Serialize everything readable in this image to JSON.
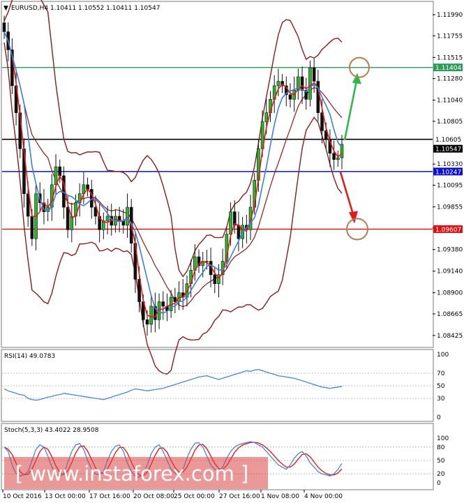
{
  "chart_data": {
    "type": "candlestick",
    "symbol_header": "EURUSD,H4  1.10411 1.10552 1.10411 1.10547",
    "symbol_marker": "▼",
    "price_axis": {
      "ylim": [
        1.083,
        1.1213
      ],
      "ticks": [
        "1.11990",
        "1.11755",
        "1.11515",
        "1.11280",
        "1.11040",
        "1.10805",
        "1.10330",
        "1.10095",
        "1.09855",
        "1.09620",
        "1.09380",
        "1.09140",
        "1.08900",
        "1.08665",
        "1.08425"
      ]
    },
    "levels": [
      {
        "name": "resistance",
        "value": 1.11404,
        "label": "1.11404",
        "color": "#2e9a5a"
      },
      {
        "name": "current",
        "value": 1.10605,
        "label": "1.10605",
        "color": "#000000"
      },
      {
        "name": "last",
        "value": 1.10547,
        "label": "1.10547",
        "color": "#000000"
      },
      {
        "name": "pivot",
        "value": 1.10247,
        "label": "1.10247",
        "color": "#1010cc"
      },
      {
        "name": "support",
        "value": 1.09607,
        "label": "1.09607",
        "color": "#dd1111"
      }
    ],
    "x_labels": [
      "10 Oct 2016",
      "13 Oct 00:00",
      "17 Oct 16:00",
      "20 Oct 08:00",
      "25 Oct 00:00",
      "27 Oct 16:00",
      "1 Nov 08:00",
      "4 Nov 00:00"
    ],
    "candles_close": [
      1.118,
      1.116,
      1.112,
      1.109,
      1.105,
      1.1,
      1.0975,
      1.095,
      1.1,
      1.099,
      1.098,
      1.0985,
      1.101,
      1.103,
      1.102,
      1.0985,
      1.096,
      1.0975,
      1.099,
      1.1,
      1.101,
      1.1005,
      1.0985,
      1.0975,
      1.096,
      1.097,
      1.0975,
      1.0965,
      1.0975,
      1.097,
      1.0965,
      1.0985,
      1.0945,
      1.0905,
      1.088,
      1.086,
      1.0855,
      1.0875,
      1.086,
      1.088,
      1.0875,
      1.087,
      1.0885,
      1.088,
      1.089,
      1.0885,
      1.09,
      1.0915,
      1.093,
      1.092,
      1.0925,
      1.0925,
      1.091,
      1.09,
      1.091,
      1.0925,
      1.0955,
      1.098,
      1.0965,
      1.095,
      1.0965,
      1.096,
      1.0985,
      1.1015,
      1.105,
      1.108,
      1.109,
      1.1105,
      1.112,
      1.1125,
      1.112,
      1.111,
      1.1105,
      1.1115,
      1.113,
      1.1115,
      1.1105,
      1.114,
      1.1125,
      1.109,
      1.107,
      1.106,
      1.1045,
      1.1038,
      1.104,
      1.1055
    ],
    "indicators": [
      {
        "name": "RSI(14) 49.0783",
        "ylim": [
          0,
          100
        ],
        "ticks": [
          "100",
          "70",
          "50",
          "30",
          "0"
        ],
        "levels": [
          70,
          50,
          30
        ],
        "value": 49.0783,
        "color": "#4a86d4",
        "values": [
          45,
          42,
          40,
          38,
          36,
          35,
          30,
          28,
          27,
          28,
          30,
          32,
          33,
          35,
          36,
          38,
          37,
          36,
          35,
          34,
          33,
          32,
          31,
          30,
          29,
          28,
          30,
          32,
          34,
          36,
          38,
          40,
          43,
          45,
          44,
          43,
          42,
          43,
          44,
          45,
          46,
          48,
          50,
          52,
          54,
          56,
          58,
          60,
          62,
          64,
          65,
          66,
          64,
          62,
          60,
          62,
          64,
          66,
          68,
          70,
          72,
          74,
          73,
          75,
          76,
          74,
          72,
          70,
          68,
          66,
          65,
          64,
          63,
          62,
          60,
          58,
          56,
          54,
          52,
          50,
          48,
          47,
          46,
          47,
          48,
          49
        ]
      },
      {
        "name": "Stoch(5,3,3) 43.4022 28.9508",
        "ylim": [
          0,
          100
        ],
        "ticks": [
          "100",
          "80",
          "50",
          "20",
          "0"
        ],
        "levels": [
          80,
          50,
          20
        ],
        "main": 43.4022,
        "signal": 28.9508,
        "main_color": "#4a86d4",
        "signal_color": "#dd1111",
        "main_values": [
          80,
          70,
          40,
          20,
          15,
          18,
          25,
          50,
          75,
          85,
          80,
          60,
          35,
          20,
          15,
          20,
          45,
          70,
          85,
          88,
          75,
          50,
          30,
          20,
          18,
          25,
          50,
          70,
          82,
          85,
          70,
          45,
          25,
          15,
          12,
          20,
          40,
          65,
          80,
          85,
          70,
          50,
          30,
          22,
          20,
          30,
          55,
          75,
          88,
          90,
          80,
          60,
          40,
          30,
          25,
          35,
          55,
          70,
          80,
          85,
          88,
          90,
          92,
          90,
          85,
          80,
          70,
          60,
          50,
          40,
          35,
          30,
          40,
          55,
          65,
          70,
          60,
          45,
          35,
          25,
          20,
          18,
          15,
          20,
          30,
          43.4
        ]
      }
    ],
    "annotations": {
      "target_up": {
        "price": 1.11404,
        "shape": "circle",
        "color": "#b87a52"
      },
      "target_down": {
        "price": 1.09607,
        "shape": "circle",
        "color": "#b87a52"
      }
    },
    "watermark": "[ www.instaforex.com ]"
  }
}
